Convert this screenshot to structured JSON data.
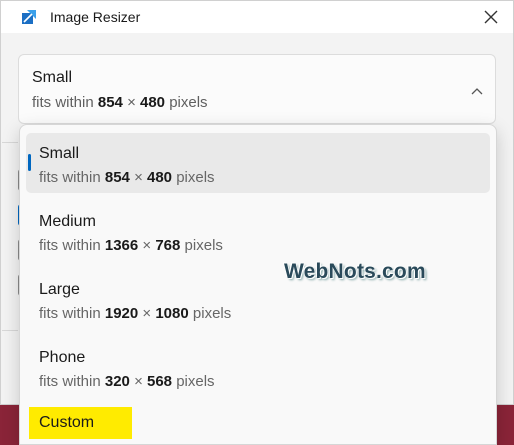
{
  "window": {
    "title": "Image Resizer",
    "app_icon": "image-resizer-icon",
    "close_icon": "close-icon"
  },
  "selected_size": {
    "name": "Small",
    "desc_prefix": "fits within",
    "width": "854",
    "times": "×",
    "height": "480",
    "unit": "pixels"
  },
  "options": [
    {
      "name": "Small",
      "desc_prefix": "fits within",
      "width": "854",
      "times": "×",
      "height": "480",
      "unit": "pixels",
      "selected": true
    },
    {
      "name": "Medium",
      "desc_prefix": "fits within",
      "width": "1366",
      "times": "×",
      "height": "768",
      "unit": "pixels"
    },
    {
      "name": "Large",
      "desc_prefix": "fits within",
      "width": "1920",
      "times": "×",
      "height": "1080",
      "unit": "pixels"
    },
    {
      "name": "Phone",
      "desc_prefix": "fits within",
      "width": "320",
      "times": "×",
      "height": "568",
      "unit": "pixels"
    },
    {
      "name": "Custom"
    }
  ],
  "watermark": "WebNots.com",
  "colors": {
    "accent": "#0067c0",
    "highlight": "#ffeb00"
  }
}
